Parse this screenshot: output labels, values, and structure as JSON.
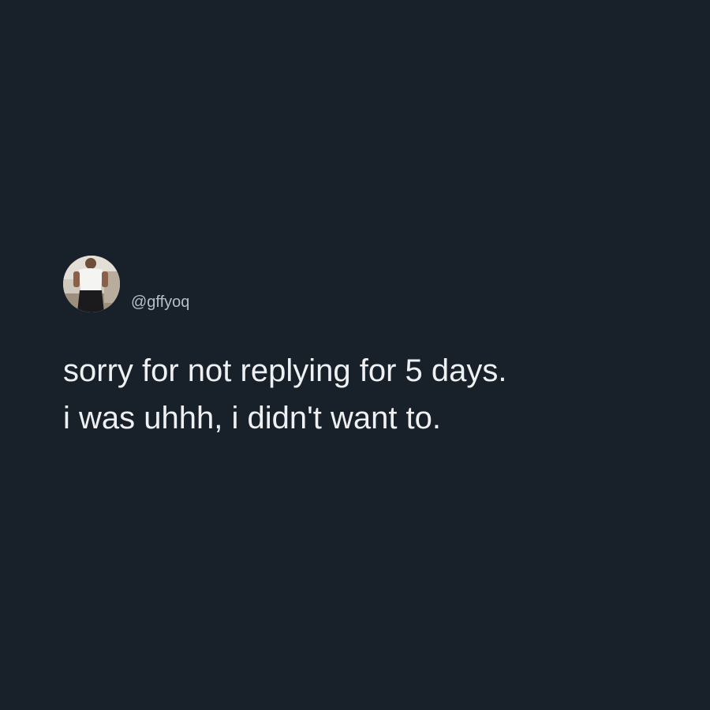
{
  "post": {
    "author": {
      "handle": "@gffyoq",
      "avatar_icon": "person-photo-avatar"
    },
    "lines": [
      "sorry for not replying for 5 days.",
      "i was uhhh, i didn't want to."
    ]
  },
  "colors": {
    "background": "#18202a",
    "text": "#eef0f2",
    "handle": "#b9bec4"
  }
}
